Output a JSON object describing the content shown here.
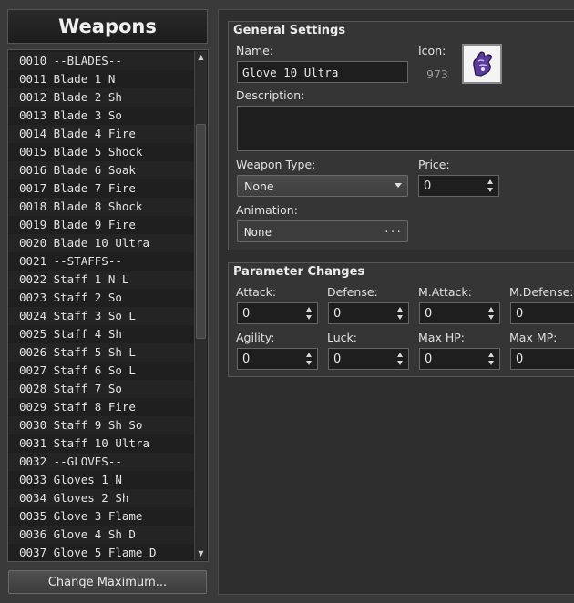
{
  "left": {
    "title": "Weapons",
    "items": [
      "0010 --BLADES--",
      "0011 Blade 1 N",
      "0012 Blade 2 Sh",
      "0013 Blade 3 So",
      "0014 Blade 4 Fire",
      "0015 Blade 5 Shock",
      "0016 Blade 6 Soak",
      "0017 Blade 7 Fire",
      "0018 Blade 8 Shock",
      "0019 Blade 9 Fire",
      "0020 Blade 10 Ultra",
      "0021 --STAFFS--",
      "0022 Staff 1 N L",
      "0023 Staff 2 So",
      "0024 Staff 3 So L",
      "0025 Staff 4 Sh",
      "0026 Staff 5 Sh L",
      "0027 Staff 6 So L",
      "0028 Staff 7 So",
      "0029 Staff 8 Fire",
      "0030 Staff 9 Sh So",
      "0031 Staff 10 Ultra",
      "0032 --GLOVES--",
      "0033 Gloves 1 N",
      "0034 Gloves 2 Sh",
      "0035 Glove 3 Flame",
      "0036 Glove 4 Sh D",
      "0037 Glove 5 Flame D"
    ],
    "change_max_label": "Change Maximum..."
  },
  "general": {
    "title": "General Settings",
    "name_label": "Name:",
    "name_value": "Glove 10 Ultra",
    "icon_label": "Icon:",
    "icon_index": "973",
    "icon_name": "purple-glove-icon",
    "description_label": "Description:",
    "description_value": "",
    "weapon_type_label": "Weapon Type:",
    "weapon_type_value": "None",
    "price_label": "Price:",
    "price_value": "0",
    "animation_label": "Animation:",
    "animation_value": "None",
    "animation_button": "..."
  },
  "params": {
    "title": "Parameter Changes",
    "fields": [
      {
        "label": "Attack:",
        "value": "0"
      },
      {
        "label": "Defense:",
        "value": "0"
      },
      {
        "label": "M.Attack:",
        "value": "0"
      },
      {
        "label": "M.Defense:",
        "value": "0"
      },
      {
        "label": "Agility:",
        "value": "0"
      },
      {
        "label": "Luck:",
        "value": "0"
      },
      {
        "label": "Max HP:",
        "value": "0"
      },
      {
        "label": "Max MP:",
        "value": "0"
      }
    ]
  },
  "colors": {
    "background": "#3a3a3a",
    "panel": "#353535",
    "field": "#1e1e1e",
    "icon_accent": "#5a3a9a"
  }
}
